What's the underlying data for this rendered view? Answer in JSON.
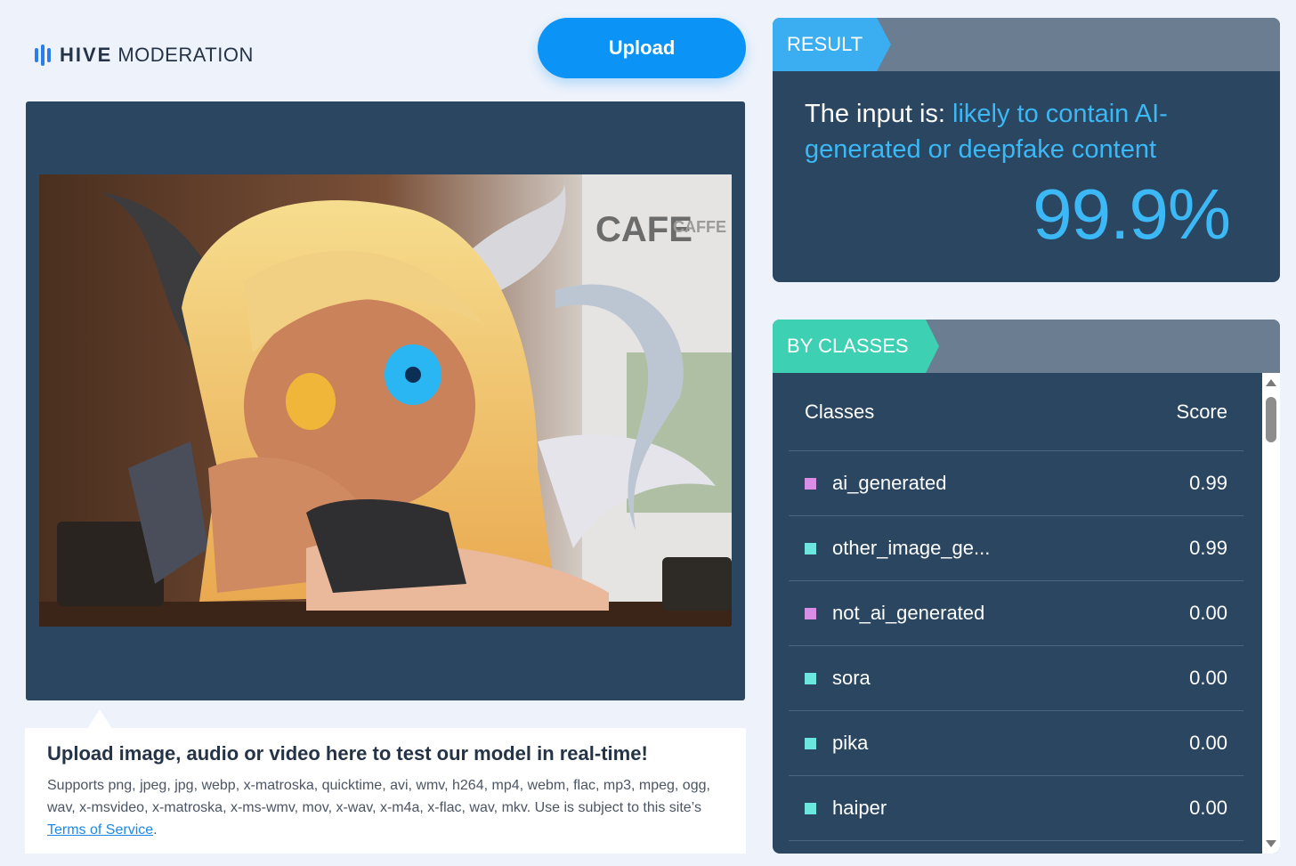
{
  "brand": {
    "bold": "HIVE",
    "light": "MODERATION",
    "icon": "hive-bars-icon"
  },
  "upload_button": "Upload",
  "preview": {
    "image_alt": "Anime illustration of a blonde dragon girl with horns and wings in a cafe",
    "cafe_sign": "CAFE",
    "cafe_sign_small": "CAFFE"
  },
  "info": {
    "title": "Upload image, audio or video here to test our model in real-time!",
    "body": "Supports png, jpeg, jpg, webp, x-matroska, quicktime, avi, wmv, h264, mp4, webm, flac, mp3, mpeg, ogg, wav, x-msvideo, x-matroska, x-ms-wmv, mov, x-wav, x-m4a, x-flac, wav, mkv. Use is subject to this site’s ",
    "tos_link": "Terms of Service",
    "tail": "."
  },
  "result": {
    "tag": "RESULT",
    "prefix": "The input is: ",
    "verdict": "likely to contain AI-generated or deepfake content",
    "percent": "99.9%"
  },
  "classes": {
    "tag": "BY CLASSES",
    "header_class": "Classes",
    "header_score": "Score",
    "rows": [
      {
        "name": "ai_generated",
        "score": "0.99",
        "color": "#d98ee6"
      },
      {
        "name": "other_image_ge...",
        "score": "0.99",
        "color": "#6de6df"
      },
      {
        "name": "not_ai_generated",
        "score": "0.00",
        "color": "#d98ee6"
      },
      {
        "name": "sora",
        "score": "0.00",
        "color": "#6de6df"
      },
      {
        "name": "pika",
        "score": "0.00",
        "color": "#6de6df"
      },
      {
        "name": "haiper",
        "score": "0.00",
        "color": "#6de6df"
      }
    ]
  },
  "colors": {
    "accent": "#0b93f6",
    "result_tag": "#3aaef0",
    "classes_tag": "#3dd0b3",
    "panel": "#2a4660"
  }
}
